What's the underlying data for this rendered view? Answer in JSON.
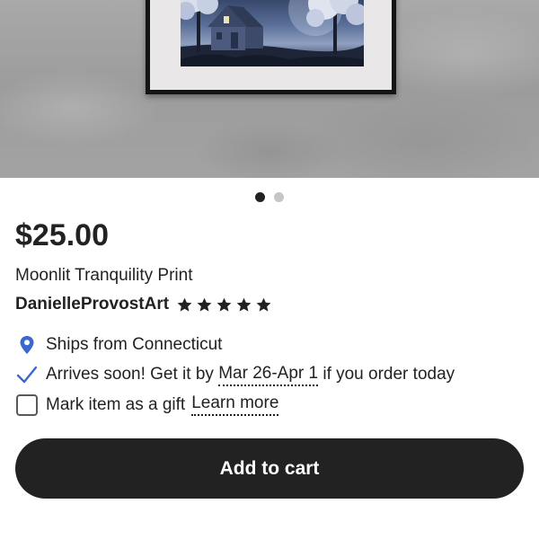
{
  "hero": {
    "image_alt": "Framed print of a moonlit house among trees",
    "carousel": {
      "total": 2,
      "active_index": 1
    }
  },
  "listing": {
    "price": "$25.00",
    "title": "Moonlit Tranquility Print",
    "shop_name": "DanielleProvostArt",
    "rating": 5,
    "rating_max": 5
  },
  "shipping": {
    "ships_from": "Ships from Connecticut",
    "arrives_prefix": "Arrives soon! Get it by ",
    "arrives_dates": "Mar 26-Apr 1",
    "arrives_suffix": " if you order today"
  },
  "gift": {
    "label": "Mark item as a gift",
    "checked": false,
    "learn_more": "Learn more"
  },
  "actions": {
    "add_to_cart": "Add to cart"
  },
  "colors": {
    "text": "#222222",
    "button_bg": "#222222",
    "button_text": "#ffffff",
    "location_icon": "#3b67d1",
    "check_icon": "#3b67d1",
    "dot_active": "#222222",
    "dot_inactive": "#c6c6c6"
  },
  "icons": {
    "location": "map-pin-icon",
    "arrives": "checkmark-icon",
    "rating": "star-icon"
  }
}
